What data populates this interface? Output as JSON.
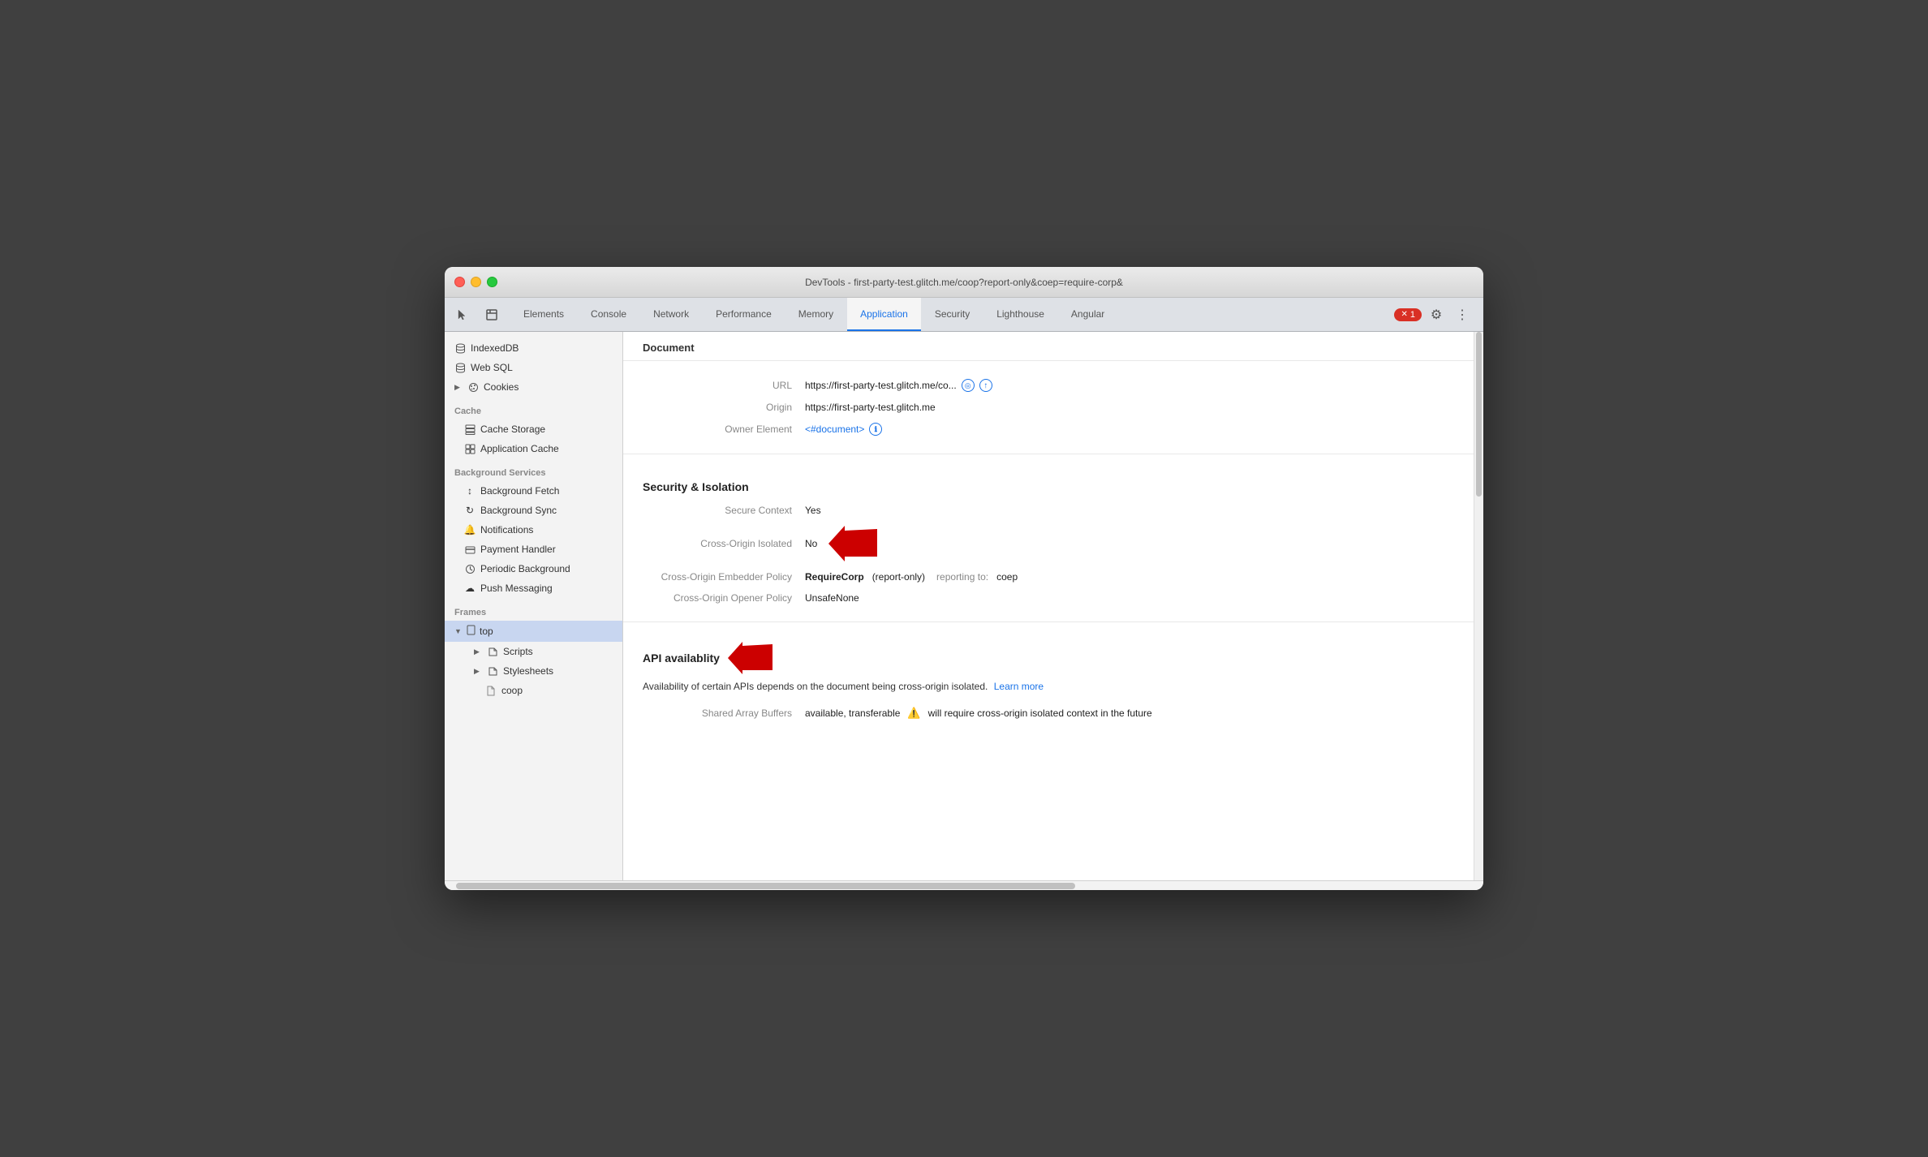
{
  "window": {
    "title": "DevTools - first-party-test.glitch.me/coop?report-only&coep=require-corp&"
  },
  "tabs": {
    "items": [
      {
        "label": "Elements",
        "active": false
      },
      {
        "label": "Console",
        "active": false
      },
      {
        "label": "Network",
        "active": false
      },
      {
        "label": "Performance",
        "active": false
      },
      {
        "label": "Memory",
        "active": false
      },
      {
        "label": "Application",
        "active": true
      },
      {
        "label": "Security",
        "active": false
      },
      {
        "label": "Lighthouse",
        "active": false
      },
      {
        "label": "Angular",
        "active": false
      }
    ],
    "error_count": "1"
  },
  "sidebar": {
    "sections": [
      {
        "items": [
          {
            "label": "IndexedDB",
            "icon": "db",
            "indent": "top"
          },
          {
            "label": "Web SQL",
            "icon": "db",
            "indent": "top"
          },
          {
            "label": "Cookies",
            "icon": "cookie",
            "indent": "top",
            "expandable": true
          }
        ]
      },
      {
        "header": "Cache",
        "items": [
          {
            "label": "Cache Storage",
            "icon": "stack",
            "indent": "sub"
          },
          {
            "label": "Application Cache",
            "icon": "grid",
            "indent": "sub"
          }
        ]
      },
      {
        "header": "Background Services",
        "items": [
          {
            "label": "Background Fetch",
            "icon": "fetch",
            "indent": "sub"
          },
          {
            "label": "Background Sync",
            "icon": "sync",
            "indent": "sub"
          },
          {
            "label": "Notifications",
            "icon": "bell",
            "indent": "sub"
          },
          {
            "label": "Payment Handler",
            "icon": "payment",
            "indent": "sub"
          },
          {
            "label": "Periodic Background",
            "icon": "periodic",
            "indent": "sub"
          },
          {
            "label": "Push Messaging",
            "icon": "cloud",
            "indent": "sub"
          }
        ]
      },
      {
        "header": "Frames",
        "items": [
          {
            "label": "top",
            "icon": "page",
            "indent": "top-expanded",
            "expandable": true,
            "expanded": true
          },
          {
            "label": "Scripts",
            "icon": "folder",
            "indent": "sub-expand",
            "expandable": true
          },
          {
            "label": "Stylesheets",
            "icon": "folder",
            "indent": "sub-expand",
            "expandable": true
          },
          {
            "label": "coop",
            "icon": "file",
            "indent": "subsub"
          }
        ]
      }
    ]
  },
  "content": {
    "document_header": "Document",
    "url_label": "URL",
    "url_value": "https://first-party-test.glitch.me/co...",
    "origin_label": "Origin",
    "origin_value": "https://first-party-test.glitch.me",
    "owner_element_label": "Owner Element",
    "owner_element_value": "<#document>",
    "security_section": "Security & Isolation",
    "secure_context_label": "Secure Context",
    "secure_context_value": "Yes",
    "cross_origin_isolated_label": "Cross-Origin Isolated",
    "cross_origin_isolated_value": "No",
    "coep_label": "Cross-Origin Embedder Policy",
    "coep_value": "RequireCorp",
    "coep_report": "(report-only)",
    "coep_reporting_label": "reporting to:",
    "coep_reporting_value": "coep",
    "coop_label": "Cross-Origin Opener Policy",
    "coop_value": "UnsafeNone",
    "api_section": "API availablity",
    "api_description": "Availability of certain APIs depends on the document being cross-origin isolated.",
    "learn_more": "Learn more",
    "shared_array_label": "Shared Array Buffers",
    "shared_array_value": "available, transferable",
    "shared_array_warning": "will require cross-origin isolated context in the future"
  }
}
